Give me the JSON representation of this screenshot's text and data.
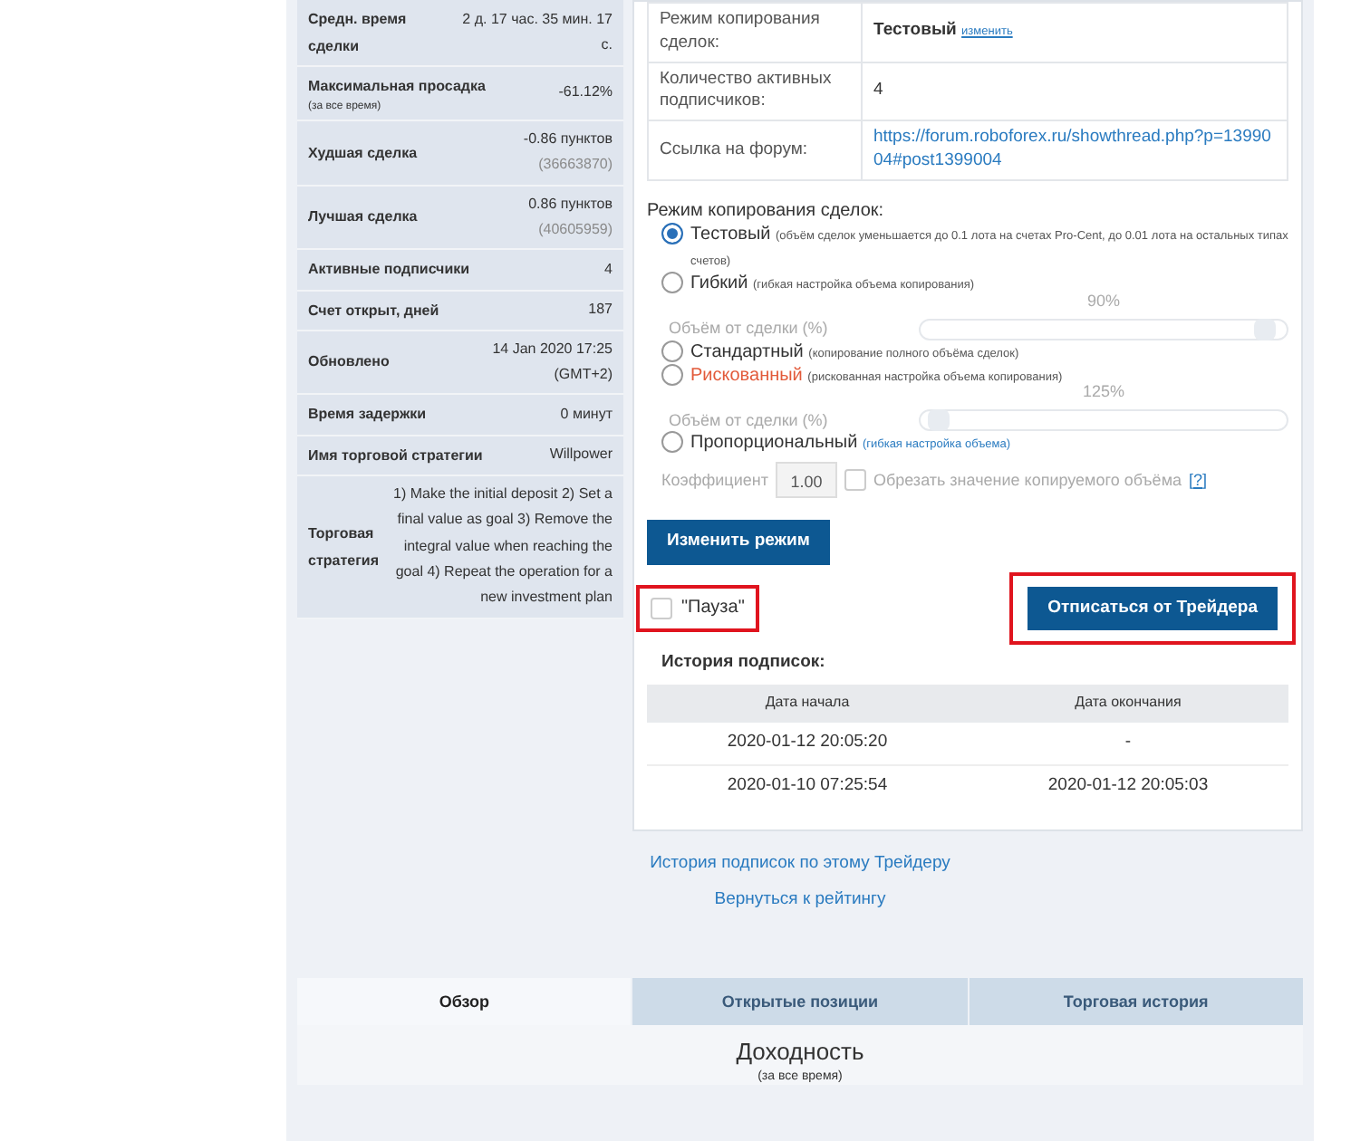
{
  "stats": [
    {
      "label": "Средн. время сделки",
      "value": "2 д. 17 час. 35 мин. 17 с."
    },
    {
      "label": "Максимальная просадка",
      "note": "(за все время)",
      "value": "-61.12%"
    },
    {
      "label": "Худшая сделка",
      "value": "-0.86 пунктов",
      "sub": "(36663870)"
    },
    {
      "label": "Лучшая сделка",
      "value": "0.86 пунктов",
      "sub": "(40605959)"
    },
    {
      "label": "Активные подписчики",
      "value": "4"
    },
    {
      "label": "Счет открыт, дней",
      "value": "187"
    },
    {
      "label": "Обновлено",
      "value": "14 Jan 2020 17:25 (GMT+2)"
    },
    {
      "label": "Время задержки",
      "value": "0 минут"
    },
    {
      "label": "Имя торговой стратегии",
      "value": "Willpower"
    },
    {
      "label": "Торговая стратегия",
      "value": "1) Make the initial deposit 2) Set a final value as goal 3) Remove the integral value when reaching the goal 4) Repeat the operation for a new investment plan"
    }
  ],
  "info": [
    {
      "label": "Режим копирования сделок:",
      "value": "Тестовый",
      "link": "изменить"
    },
    {
      "label": "Количество активных подписчиков:",
      "value": "4"
    },
    {
      "label": "Ссылка на форум:",
      "url": "https://forum.roboforex.ru/showthread.php?p=1399004#post1399004"
    }
  ],
  "mode_heading": "Режим копирования сделок:",
  "modes": [
    {
      "kind": "radio",
      "label": "Тестовый",
      "hint": "(объём сделок уменьшается до 0.1 лота на счетах Pro-Cent, до 0.01 лота на остальных типах счетов)",
      "selected": true,
      "risky": false
    },
    {
      "kind": "radio",
      "label": "Гибкий",
      "hint": "(гибкая настройка объема копирования)",
      "selected": false,
      "risky": false
    },
    {
      "kind": "slider",
      "label": "Объём от сделки (%)",
      "reading": "90%",
      "level": 0.97
    },
    {
      "kind": "radio",
      "label": "Стандартный",
      "hint": "(копирование полного объёма сделок)",
      "selected": false,
      "risky": false
    },
    {
      "kind": "radio",
      "label": "Рискованный",
      "hint": "(рискованная настройка объема копирования)",
      "selected": false,
      "risky": true
    },
    {
      "kind": "slider",
      "label": "Объём от сделки (%)",
      "reading": "125%",
      "level": 0.02
    },
    {
      "kind": "radio",
      "label": "Пропорциональный",
      "hint": "(гибкая настройка объема)",
      "selected": false,
      "risky": false,
      "hint_link": true
    },
    {
      "kind": "coef",
      "label": "Коэффициент",
      "value": "1.00",
      "checkbox_label": "Обрезать значение копируемого объёма",
      "help": "[?]",
      "checked": false
    }
  ],
  "change_button": "Изменить режим",
  "pause": {
    "label": "\"Пауза\"",
    "checked": false,
    "highlighted": true
  },
  "unsubscribe": {
    "label": "Отписаться от Трейдера",
    "highlighted": true
  },
  "history": {
    "title": "История подписок:",
    "columns": [
      "Дата начала",
      "Дата окончания"
    ],
    "rows": [
      [
        "2020-01-12 20:05:20",
        "-"
      ],
      [
        "2020-01-10 07:25:54",
        "2020-01-12 20:05:03"
      ]
    ]
  },
  "links": [
    "История подписок по этому Трейдеру",
    "Вернуться к рейтингу"
  ],
  "tabs": [
    {
      "label": "Обзор",
      "selected": true
    },
    {
      "label": "Открытые позиции",
      "selected": false
    },
    {
      "label": "Торговая история",
      "selected": false
    }
  ],
  "section_title": "Доходность",
  "section_note": "(за все время)"
}
